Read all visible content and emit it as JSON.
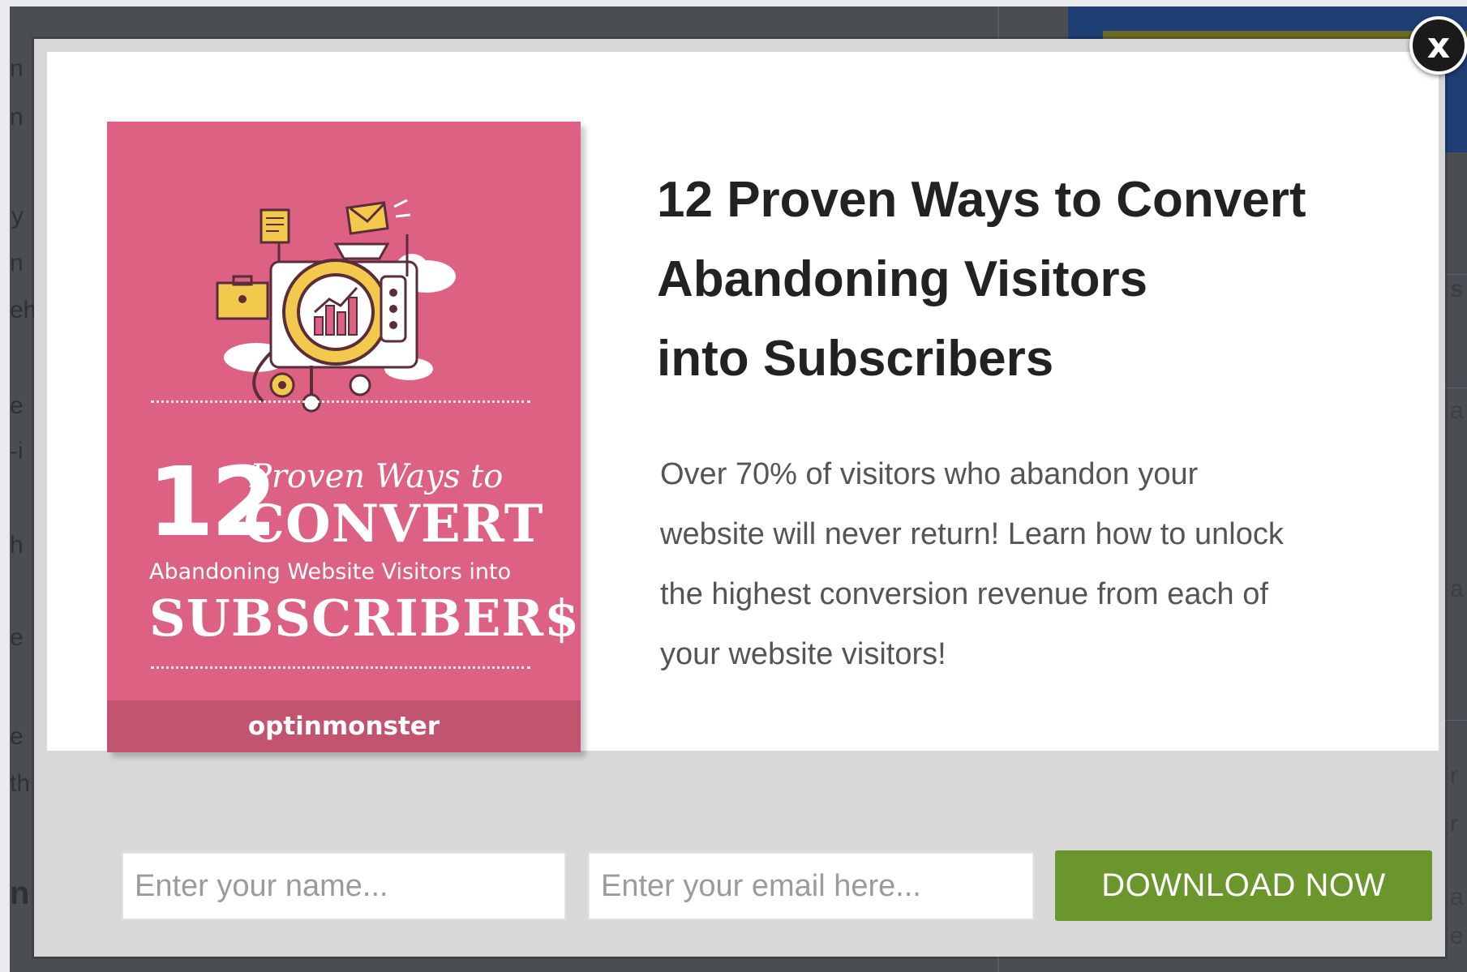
{
  "modal": {
    "close_label": "x",
    "book": {
      "number": "12",
      "proven": "Proven Ways to",
      "convert": "CONVERT",
      "abandoning": "Abandoning Website Visitors into",
      "subscribers": "SUBSCRIBER$",
      "logo": "optinmonster"
    },
    "headline": {
      "line1": "12 Proven Ways to Convert",
      "line2": "Abandoning Visitors",
      "line3": "into Subscribers"
    },
    "body": {
      "line1": "Over 70% of visitors who abandon your",
      "line2": "website will never return! Learn how to unlock",
      "line3": "the highest conversion revenue from each of",
      "line4": "your website visitors!"
    },
    "form": {
      "name_placeholder": "Enter your name...",
      "email_placeholder": "Enter your email here...",
      "button_label": "DOWNLOAD NOW"
    }
  },
  "background_fragments": [
    "n",
    "n",
    "y",
    "n",
    "eh",
    "e",
    "-i",
    "h",
    "a",
    "e",
    "e",
    "th",
    "n",
    "s",
    "a",
    "a",
    "r",
    "r",
    "e"
  ],
  "colors": {
    "book_pink": "#dc6182",
    "button_green": "#6a962d",
    "headline_text": "#222222",
    "body_text": "#555555"
  }
}
